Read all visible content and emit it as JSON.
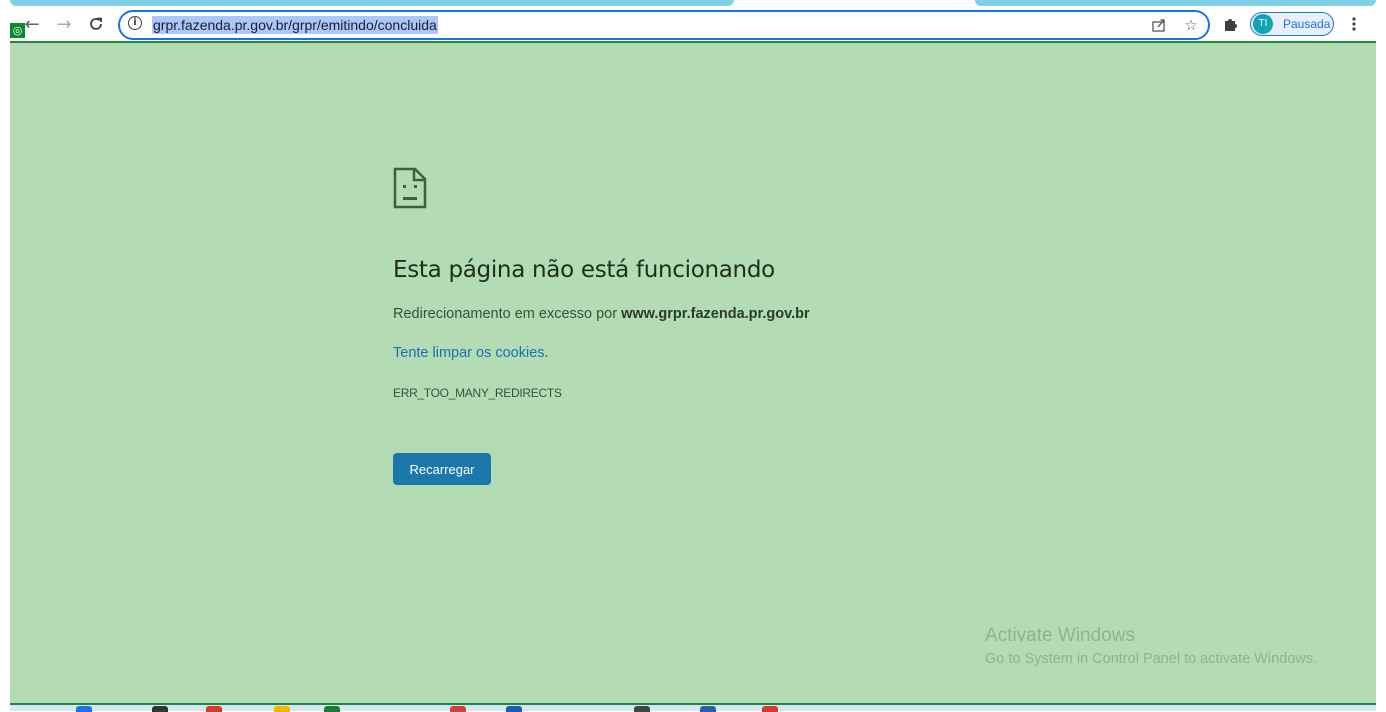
{
  "browser": {
    "nav": {
      "back_icon": "arrow-left-icon",
      "forward_icon": "arrow-right-icon",
      "reload_icon": "reload-icon"
    },
    "address_bar": {
      "info_icon": "info-icon",
      "url": "grpr.fazenda.pr.gov.br/grpr/emitindo/concluida",
      "share_icon": "share-icon",
      "bookmark_icon": "star-icon"
    },
    "extensions_icon": "puzzle-icon",
    "profile": {
      "initials": "TI",
      "status": "Pausada"
    },
    "menu_icon": "kebab-menu-icon"
  },
  "error_page": {
    "icon": "sad-page-icon",
    "title": "Esta página não está funcionando",
    "description_prefix": "Redirecionamento em excesso por ",
    "host": "www.grpr.fazenda.pr.gov.br",
    "suggestion_link": "Tente limpar os cookies",
    "suggestion_suffix": ".",
    "error_code": "ERR_TOO_MANY_REDIRECTS",
    "reload_button": "Recarregar"
  },
  "watermark": {
    "title": "Activate Windows",
    "subtitle": "Go to System in Control Panel to activate Windows."
  },
  "colors": {
    "page_background": "#b4dcb4",
    "accent": "#1a73e8",
    "button": "#1b78ab",
    "link": "#1a6fb5"
  }
}
